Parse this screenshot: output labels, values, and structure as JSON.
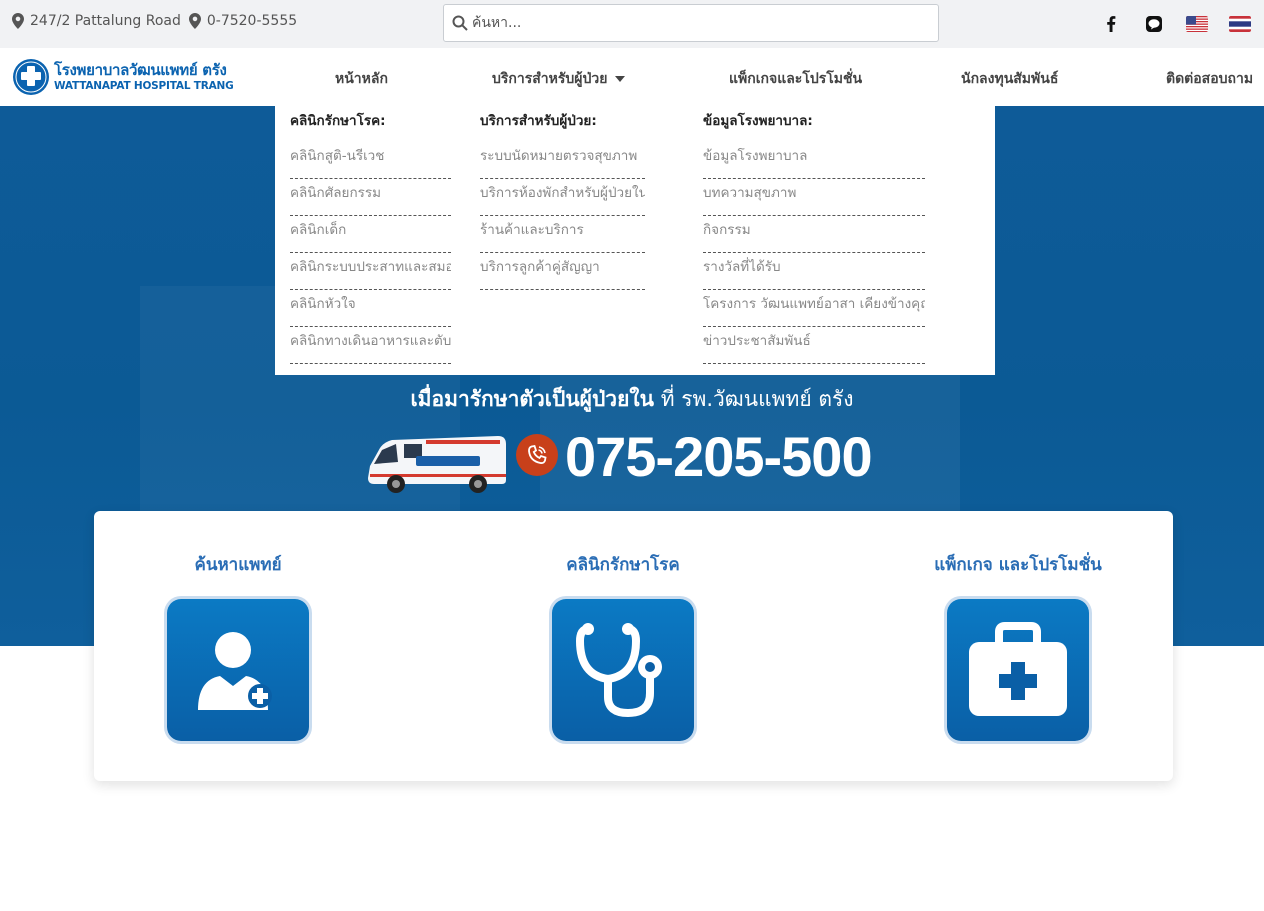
{
  "topbar": {
    "address": "247/2 Pattalung Road",
    "phone": "0-7520-5555",
    "search_placeholder": "ค้นหา...",
    "social": [
      "facebook-icon",
      "line-icon"
    ],
    "languages": [
      "us-flag",
      "th-flag"
    ]
  },
  "logo": {
    "name_th": "โรงพยาบาลวัฒนแพทย์ ตรัง",
    "name_en": "WATTANAPAT HOSPITAL TRANG"
  },
  "nav": {
    "home": "หน้าหลัก",
    "services": "บริการสำหรับผู้ป่วย",
    "packages": "แพ็กเกจและโปรโมชั่น",
    "investors": "นักลงทุนสัมพันธ์",
    "contact": "ติดต่อสอบถาม"
  },
  "dropdown": {
    "clinics": {
      "heading": "คลินิกรักษาโรค:",
      "items": [
        "คลินิกสูติ-นรีเวช",
        "คลินิกศัลยกรรม",
        "คลินิกเด็ก",
        "คลินิกระบบประสาทและสมอง",
        "คลินิกหัวใจ",
        "คลินิกทางเดินอาหารและตับ"
      ]
    },
    "services": {
      "heading": "บริการสำหรับผู้ป่วย:",
      "items": [
        "ระบบนัดหมายตรวจสุขภาพ",
        "บริการห้องพักสำหรับผู้ป่วยใน",
        "ร้านค้าและบริการ",
        "บริการลูกค้าคู่สัญญา"
      ]
    },
    "info": {
      "heading": "ข้อมูลโรงพยาบาล:",
      "items": [
        "ข้อมูลโรงพยาบาล",
        "บทความสุขภาพ",
        "กิจกรรม",
        "รางวัลที่ได้รับ",
        "โครงการ วัฒนแพทย์อาสา เคียงข้างคุณ",
        "ข่าวประชาสัมพันธ์"
      ]
    }
  },
  "hero": {
    "line_bold": "เมื่อมารักษาตัวเป็นผู้ป่วยใน",
    "line_rest": " ที่ รพ.วัฒนแพทย์ ตรัง",
    "hotline": "075-205-500"
  },
  "cards": [
    {
      "title": "ค้นหาแพทย์",
      "icon": "doctor-icon"
    },
    {
      "title": "คลินิกรักษาโรค",
      "icon": "stethoscope-icon"
    },
    {
      "title": "แพ็กเกจ และโปรโมชั่น",
      "icon": "medical-kit-icon"
    }
  ],
  "colors": {
    "brand_blue": "#0b63b0",
    "hero_blue": "#0e5b98",
    "card_title": "#2a6db5",
    "phone_accent": "#c8401a"
  }
}
